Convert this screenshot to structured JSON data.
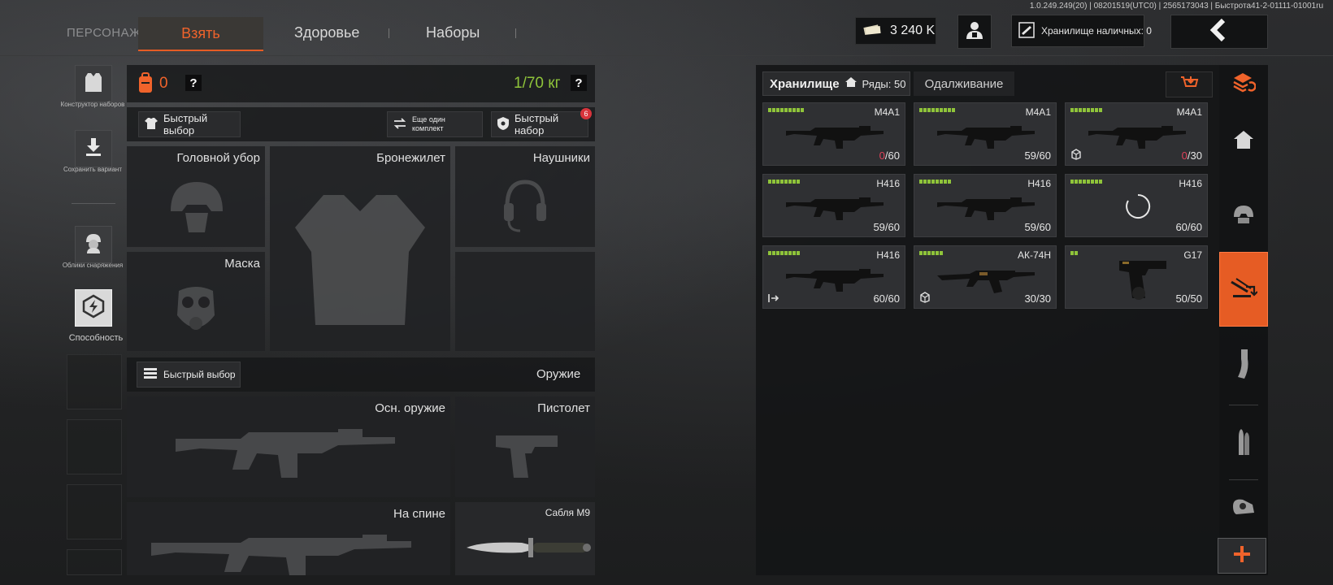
{
  "version": "1.0.249.249(20) | 08201519(UTC0) | 2565173043 | Быстрота41-2-01111-01001ru",
  "header": {
    "tab_character": "ПЕРСОНАЖ",
    "tab_take": "Взять",
    "tab_health": "Здоровье",
    "tab_kits": "Наборы",
    "money": "3 240 K",
    "cash_storage": "Хранилище наличных: 0"
  },
  "sidebar": {
    "kit_builder": "Конструктор наборов",
    "save_variant": "Сохранить вариант",
    "gear_skins": "Облики снаряжения",
    "ability": "Способность"
  },
  "loadout": {
    "backpack_count": "0",
    "help": "?",
    "weight": "1/70 кг",
    "quick_pick": "Быстрый выбор",
    "another_kit": "Еще один комплект",
    "quick_kit": "Быстрый набор",
    "quick_kit_badge": "6",
    "slots": {
      "headgear": "Головной убор",
      "vest": "Бронежилет",
      "headphones": "Наушники",
      "mask": "Маска",
      "weapon_section": "Оружие",
      "weapon_quick_pick": "Быстрый выбор",
      "primary": "Осн. оружие",
      "pistol": "Пистолет",
      "back": "На спине",
      "melee": "Сабля М9"
    }
  },
  "storage": {
    "tab_storage": "Хранилище",
    "rows_label": "Ряды: 50",
    "tab_lending": "Одалживание",
    "items": [
      {
        "name": "M4A1",
        "ammo_current": "0",
        "ammo_total": "60",
        "empty": true,
        "bars": 9,
        "icon": ""
      },
      {
        "name": "M4A1",
        "ammo_current": "59",
        "ammo_total": "60",
        "empty": false,
        "bars": 9,
        "icon": ""
      },
      {
        "name": "M4A1",
        "ammo_current": "0",
        "ammo_total": "30",
        "empty": true,
        "bars": 8,
        "icon": "box-icon"
      },
      {
        "name": "H416",
        "ammo_current": "59",
        "ammo_total": "60",
        "empty": false,
        "bars": 8,
        "icon": ""
      },
      {
        "name": "H416",
        "ammo_current": "59",
        "ammo_total": "60",
        "empty": false,
        "bars": 8,
        "icon": ""
      },
      {
        "name": "H416",
        "ammo_current": "60",
        "ammo_total": "60",
        "empty": false,
        "bars": 8,
        "icon": "loading-icon"
      },
      {
        "name": "H416",
        "ammo_current": "60",
        "ammo_total": "60",
        "empty": false,
        "bars": 8,
        "icon": "exit-icon"
      },
      {
        "name": "АК-74Н",
        "ammo_current": "30",
        "ammo_total": "30",
        "empty": false,
        "bars": 6,
        "icon": "box-icon"
      },
      {
        "name": "G17",
        "ammo_current": "50",
        "ammo_total": "50",
        "empty": false,
        "bars": 2,
        "icon": ""
      }
    ]
  },
  "rail": {
    "items": [
      "stack-refresh-icon",
      "home-icon",
      "helmet-icon",
      "weapon-storage-icon",
      "magazine-icon",
      "ammo-icon",
      "scope-icon",
      "plus-icon"
    ],
    "active": "weapon-storage-icon"
  },
  "colors": {
    "accent": "#e65c24",
    "weight_green": "#8fc43a",
    "ammo_zero": "#e0425a"
  }
}
